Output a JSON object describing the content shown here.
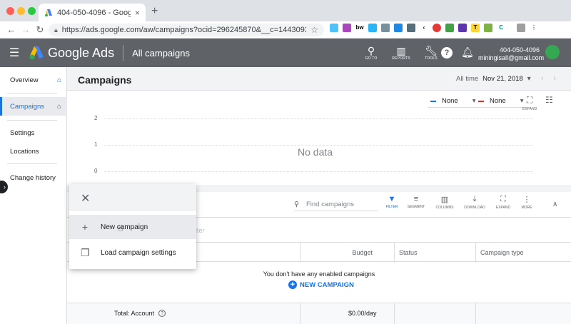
{
  "browser": {
    "tab_title": "404-050-4096 - Google Ads",
    "url": "https://ads.google.com/aw/campaigns?ocid=296245870&__c=1443093630&a...",
    "new_tab": "+",
    "tab_close": "×"
  },
  "header": {
    "product": "Google Ads",
    "page": "All campaigns",
    "tools": [
      {
        "label": "GO TO",
        "icon": "search-icon"
      },
      {
        "label": "REPORTS",
        "icon": "reports-icon"
      },
      {
        "label": "TOOLS",
        "icon": "wrench-icon"
      }
    ],
    "help": "?",
    "account_id": "404-050-4096",
    "account_email": "miningisall@gmail.com"
  },
  "sidebar": {
    "items": [
      {
        "label": "Overview"
      },
      {
        "label": "Campaigns"
      },
      {
        "label": "Settings"
      },
      {
        "label": "Locations"
      },
      {
        "label": "Change history"
      }
    ]
  },
  "main": {
    "title": "Campaigns",
    "range_label": "All time",
    "range_date": "Nov 21, 2018"
  },
  "chart": {
    "metric1": "None",
    "metric2": "None",
    "metric1_color": "#1a73e8",
    "metric2_color": "#d93025",
    "expand_label": "EXPAND",
    "y_ticks": [
      "2",
      "1",
      "0"
    ],
    "empty_text": "No data"
  },
  "table": {
    "search_placeholder": "Find campaigns",
    "tools": [
      {
        "label": "FILTER",
        "icon": "filter-icon"
      },
      {
        "label": "SEGMENT",
        "icon": "segment-icon"
      },
      {
        "label": "COLUMNS",
        "icon": "columns-icon"
      },
      {
        "label": "DOWNLOAD",
        "icon": "download-icon"
      },
      {
        "label": "EXPAND",
        "icon": "expand-icon"
      },
      {
        "label": "MORE",
        "icon": "more-icon"
      }
    ],
    "add_filter": "d filter",
    "columns": [
      "Budget",
      "Status",
      "Campaign type"
    ],
    "empty_message": "You don't have any enabled campaigns",
    "new_campaign": "NEW CAMPAIGN",
    "total_label": "Total: Account",
    "total_budget": "$0.00/day"
  },
  "popup": {
    "items": [
      {
        "label": "New campaign",
        "icon": "plus-icon"
      },
      {
        "label": "Load campaign settings",
        "icon": "copy-icon"
      }
    ]
  }
}
